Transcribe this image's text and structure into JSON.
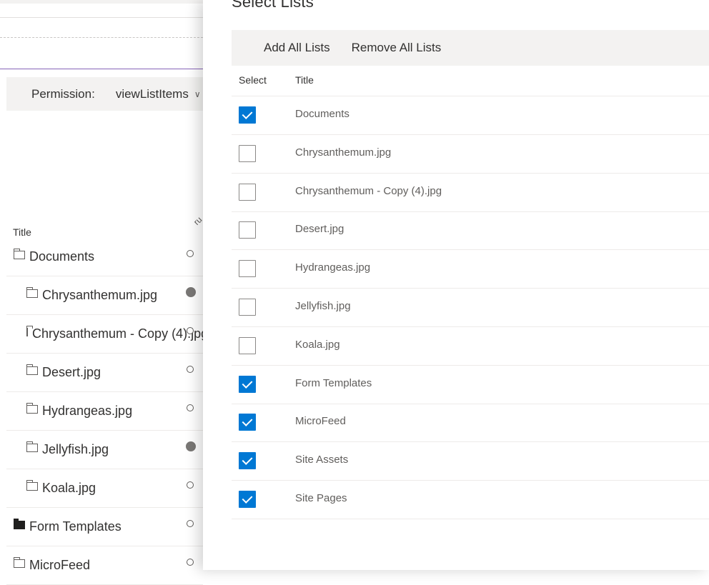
{
  "background": {
    "permission_label": "Permission:",
    "permission_value": "viewListItems",
    "column_title": "Title",
    "column_rotated": "ru",
    "rows": [
      {
        "name": "Documents",
        "folder": "outline",
        "level": 0,
        "status": "empty"
      },
      {
        "name": "Chrysanthemum.jpg",
        "folder": "outline",
        "level": 1,
        "status": "filled"
      },
      {
        "name": "Chrysanthemum - Copy (4).jpg",
        "folder": "outline",
        "level": 1,
        "status": "empty"
      },
      {
        "name": "Desert.jpg",
        "folder": "outline",
        "level": 1,
        "status": "empty"
      },
      {
        "name": "Hydrangeas.jpg",
        "folder": "outline",
        "level": 1,
        "status": "empty"
      },
      {
        "name": "Jellyfish.jpg",
        "folder": "outline",
        "level": 1,
        "status": "filled"
      },
      {
        "name": "Koala.jpg",
        "folder": "outline",
        "level": 1,
        "status": "empty"
      },
      {
        "name": "Form Templates",
        "folder": "solid",
        "level": 0,
        "status": "empty"
      },
      {
        "name": "MicroFeed",
        "folder": "outline",
        "level": 0,
        "status": "empty"
      }
    ]
  },
  "panel": {
    "title": "Select Lists",
    "add_all_label": "Add All Lists",
    "remove_all_label": "Remove All Lists",
    "header_select": "Select",
    "header_title": "Title",
    "accent_color": "#0078d4",
    "lists": [
      {
        "title": "Documents",
        "checked": true
      },
      {
        "title": "Chrysanthemum.jpg",
        "checked": false
      },
      {
        "title": "Chrysanthemum - Copy (4).jpg",
        "checked": false
      },
      {
        "title": "Desert.jpg",
        "checked": false
      },
      {
        "title": "Hydrangeas.jpg",
        "checked": false
      },
      {
        "title": "Jellyfish.jpg",
        "checked": false
      },
      {
        "title": "Koala.jpg",
        "checked": false
      },
      {
        "title": "Form Templates",
        "checked": true
      },
      {
        "title": "MicroFeed",
        "checked": true
      },
      {
        "title": "Site Assets",
        "checked": true
      },
      {
        "title": "Site Pages",
        "checked": true
      }
    ]
  }
}
